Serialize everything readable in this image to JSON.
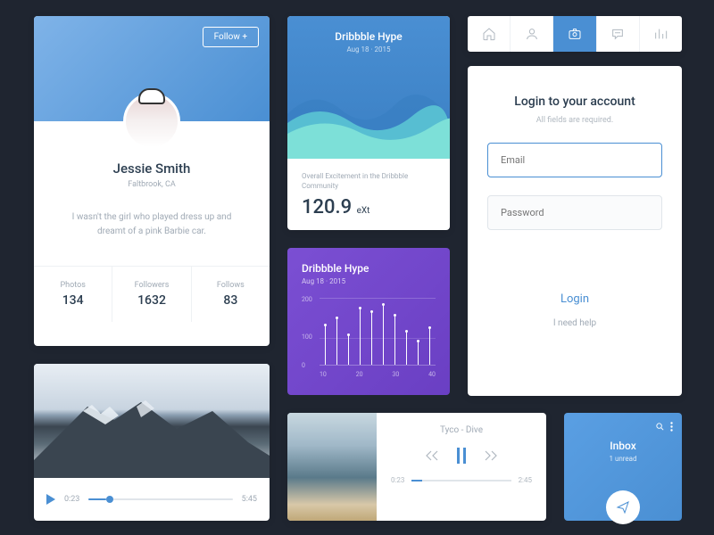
{
  "profile": {
    "follow_label": "Follow +",
    "name": "Jessie Smith",
    "location": "Faltbrook, CA",
    "bio": "I wasn't the girl who played dress up and dreamt of a pink Barbie car.",
    "stats": [
      {
        "label": "Photos",
        "value": "134"
      },
      {
        "label": "Followers",
        "value": "1632"
      },
      {
        "label": "Follows",
        "value": "83"
      }
    ]
  },
  "wave_card": {
    "title": "Dribbble Hype",
    "date": "Aug 18 · 2015",
    "description": "Overall Excitement in the Dribbble Community",
    "value": "120.9",
    "unit": "eXt"
  },
  "purple_card": {
    "title": "Dribbble Hype",
    "date": "Aug 18 · 2015"
  },
  "chart_data": {
    "type": "bar",
    "y_ticks": [
      "200",
      "100",
      "0"
    ],
    "x_ticks": [
      "10",
      "20",
      "30",
      "40"
    ],
    "values": [
      120,
      140,
      90,
      170,
      160,
      180,
      150,
      100,
      70,
      110
    ],
    "ylim": [
      0,
      200
    ]
  },
  "login": {
    "title": "Login to your account",
    "subtitle": "All fields are required.",
    "email_placeholder": "Email",
    "password_placeholder": "Password",
    "button": "Login",
    "help": "I need help"
  },
  "video": {
    "current": "0:23",
    "duration": "5:45"
  },
  "music": {
    "track": "Tyco - Dive",
    "current": "0:23",
    "duration": "2:45"
  },
  "inbox": {
    "title": "Inbox",
    "subtitle": "1 unread"
  }
}
